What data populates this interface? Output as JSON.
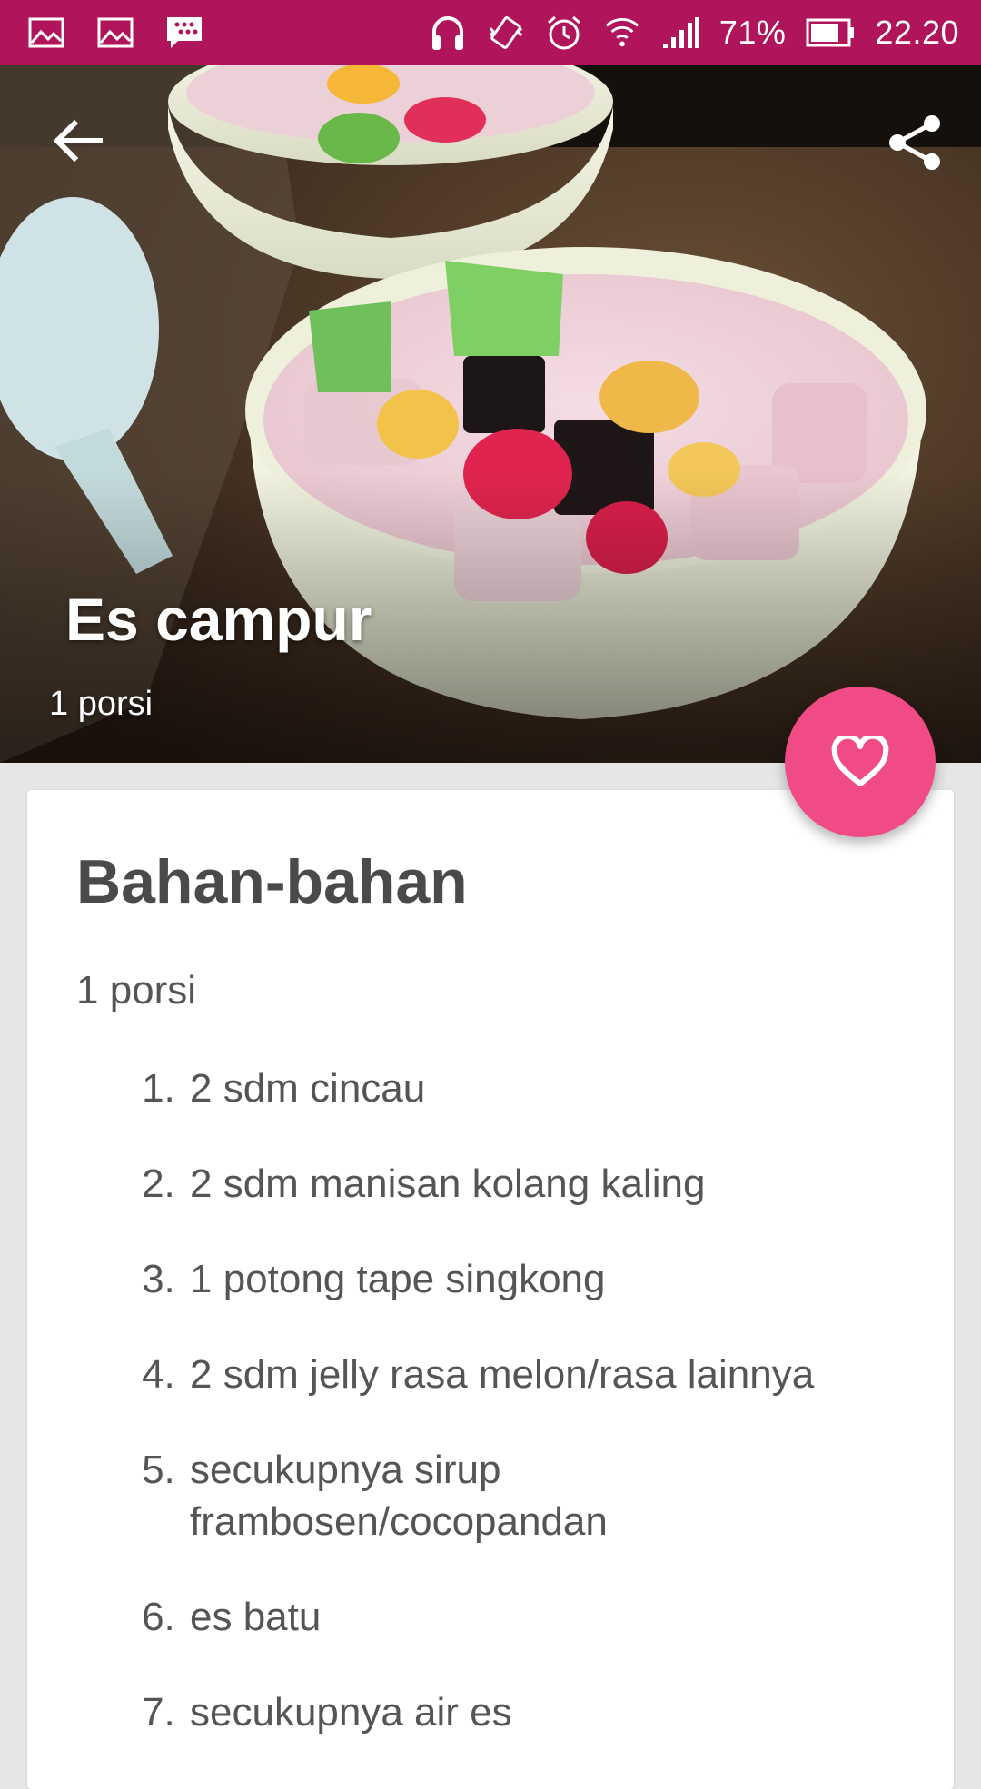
{
  "status_bar": {
    "battery": "71%",
    "time": "22.20",
    "left_icons": [
      "image-icon",
      "image-icon",
      "bbm-icon"
    ],
    "right_icons": [
      "headphones-icon",
      "vibrate-icon",
      "alarm-icon",
      "wifi-icon",
      "signal-icon",
      "battery-icon"
    ],
    "color": "#b0145a"
  },
  "hero": {
    "title": "Es campur",
    "subtitle": "1 porsi",
    "back_icon": "arrow-left-icon",
    "share_icon": "share-icon"
  },
  "fab": {
    "icon": "heart-icon",
    "color": "#f04b86"
  },
  "ingredients": {
    "title": "Bahan-bahan",
    "portion": "1 porsi",
    "items": [
      "2 sdm cincau",
      "2 sdm manisan kolang kaling",
      "1 potong tape singkong",
      "2 sdm jelly rasa melon/rasa lainnya",
      "secukupnya sirup frambosen/cocopandan",
      "es batu",
      "secukupnya air es"
    ]
  }
}
